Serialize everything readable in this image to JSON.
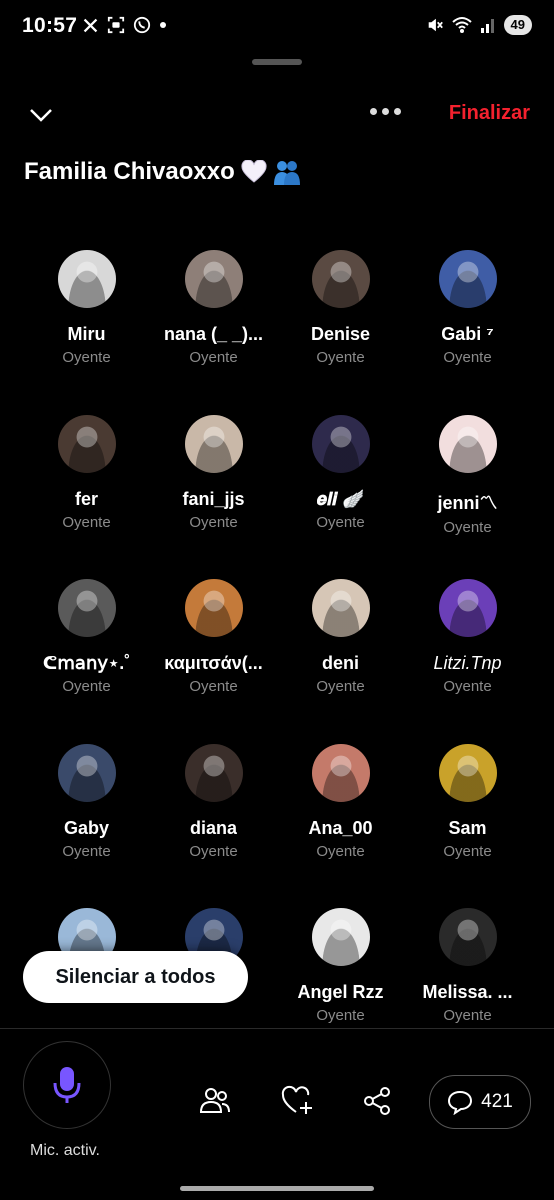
{
  "status_bar": {
    "time": "10:57",
    "battery": "49"
  },
  "header": {
    "end_label": "Finalizar"
  },
  "space": {
    "title": "Familia Chivaoxxo"
  },
  "participants": [
    {
      "name": "Miru",
      "role": "Oyente",
      "color": "#d8d8d8"
    },
    {
      "name": "nana (_ _)...",
      "role": "Oyente",
      "color": "#8e7f78"
    },
    {
      "name": "Denise",
      "role": "Oyente",
      "color": "#5a4a42"
    },
    {
      "name": "Gabi ⁷",
      "role": "Oyente",
      "color": "#3f5da6"
    },
    {
      "name": "fer",
      "role": "Oyente",
      "color": "#4a3a32"
    },
    {
      "name": "fani_jjs",
      "role": "Oyente",
      "color": "#c9b8a8"
    },
    {
      "name": "𝒆𝒍𝒊 🪽",
      "role": "Oyente",
      "color": "#2e2a4c"
    },
    {
      "name": "jenni〽",
      "role": "Oyente",
      "color": "#f2dede"
    },
    {
      "name": "ᕦ𝗆𝖺𝗇𝗒⋆.˚",
      "role": "Oyente",
      "color": "#5a5a5a"
    },
    {
      "name": "καμιτσάν(...",
      "role": "Oyente",
      "color": "#c47a3a"
    },
    {
      "name": "deni",
      "role": "Oyente",
      "color": "#d6c6b6"
    },
    {
      "name": "Litzi.Tnp",
      "role": "Oyente",
      "color": "#6b3fb8",
      "italic": true
    },
    {
      "name": "Gaby",
      "role": "Oyente",
      "color": "#3a4a6a"
    },
    {
      "name": "diana",
      "role": "Oyente",
      "color": "#3a2e2a"
    },
    {
      "name": "Ana_00",
      "role": "Oyente",
      "color": "#c47a6a"
    },
    {
      "name": "Sam",
      "role": "Oyente",
      "color": "#c9a22a"
    },
    {
      "name": "",
      "role": "Oyente",
      "color": "#9ab8d8"
    },
    {
      "name": "",
      "role": "Oyente",
      "color": "#2a3e6a"
    },
    {
      "name": "Angel Rzz",
      "role": "Oyente",
      "color": "#e8e8e8"
    },
    {
      "name": "Melissa. ...",
      "role": "Oyente",
      "color": "#2a2a2a"
    }
  ],
  "actions": {
    "mute_all": "Silenciar a todos",
    "mic_label": "Mic. activ.",
    "comments_count": "421"
  },
  "colors": {
    "accent": "#f4212e",
    "mic": "#7856ff"
  }
}
